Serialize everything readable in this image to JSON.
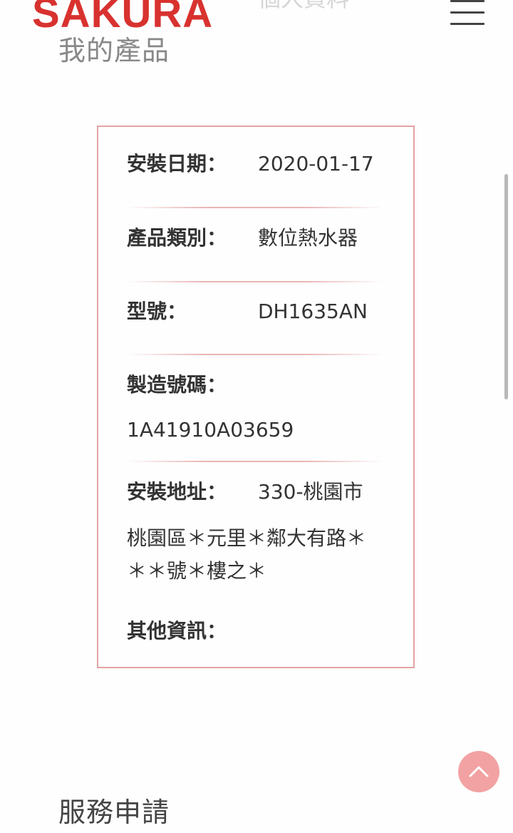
{
  "header": {
    "brand": "SAKURA",
    "faded_text": "個人資料",
    "menu_icon": "hamburger-menu-icon"
  },
  "section_my_products": {
    "title": "我的產品"
  },
  "product": {
    "install_date_label": "安裝日期：",
    "install_date_value": "2020-01-17",
    "category_label": "產品類別：",
    "category_value": "數位熱水器",
    "model_label": "型號：",
    "model_value": "DH1635AN",
    "serial_label": "製造號碼：",
    "serial_value": "1A41910A03659",
    "address_label": "安裝地址：",
    "address_value_line1": "330-桃園市",
    "address_value_rest": "桃園區＊元里＊鄰大有路＊＊＊號＊樓之＊",
    "other_info_label": "其他資訊："
  },
  "section_service": {
    "title": "服務申請"
  },
  "controls": {
    "back_to_top_icon": "chevron-up-icon",
    "accent_color": "#d8322f",
    "card_border_color": "#e4a3a3",
    "back_to_top_color": "#f2a2a2"
  }
}
